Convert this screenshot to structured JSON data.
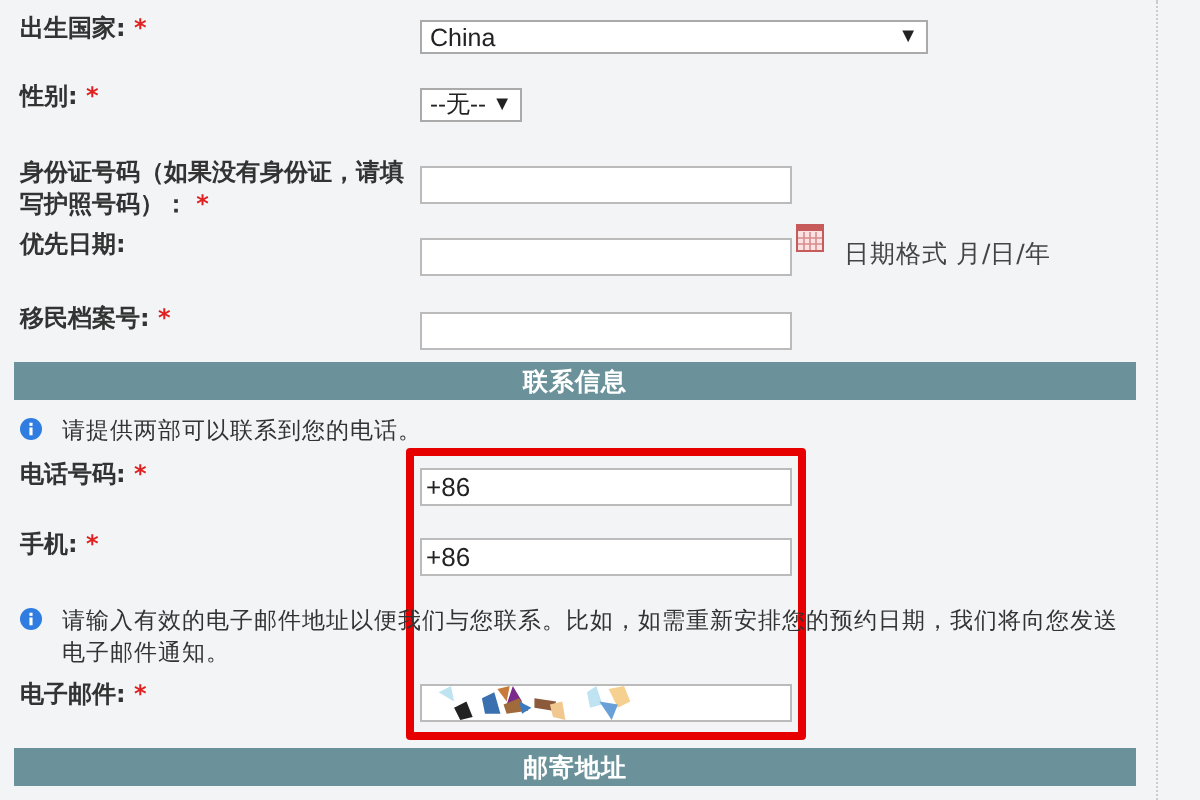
{
  "items": [
    {
      "kind": "select",
      "label": "出生国家:",
      "required": true,
      "value": "China"
    },
    {
      "kind": "short-select",
      "label": "性别:",
      "required": true,
      "value": "--无--"
    },
    {
      "kind": "text",
      "label": "身份证号码（如果没有身份证，请填写护照号码）：",
      "required": true
    },
    {
      "kind": "date",
      "label": "优先日期:",
      "required": false,
      "hint": "日期格式 月/日/年"
    },
    {
      "kind": "text",
      "label": "移民档案号:",
      "required": true
    },
    {
      "kind": "header",
      "label": "联系信息"
    },
    {
      "kind": "note",
      "label": "请提供两部可以联系到您的电话。"
    },
    {
      "kind": "text",
      "label": "电话号码:",
      "required": true,
      "value": "+86"
    },
    {
      "kind": "text",
      "label": "手机:",
      "required": true,
      "value": "+86"
    },
    {
      "kind": "note",
      "label": "请输入有效的电子邮件地址以便我们与您联系。比如，如需重新安排您的预约日期，我们将向您发送电子邮件通知。"
    },
    {
      "kind": "obscured",
      "label": "电子邮件:",
      "required": true
    },
    {
      "kind": "header",
      "label": "邮寄地址"
    }
  ],
  "required_mark": "*",
  "select_arrow": "▼"
}
